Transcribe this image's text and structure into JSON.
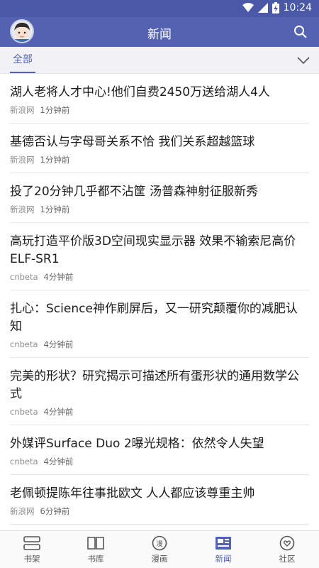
{
  "status": {
    "time": "10:24",
    "battery_icon": "battery-charging-icon",
    "signal_icon": "signal-icon",
    "wifi_icon": "wifi-icon"
  },
  "header": {
    "title": "新闻",
    "search_icon": "search-icon",
    "avatar": "user-avatar"
  },
  "tabs": {
    "active": "全部",
    "expand_icon": "chevron-down-icon"
  },
  "news": [
    {
      "headline": "湖人老将人才中心!他们自费2450万送给湖人4人",
      "source": "新浪网",
      "time": "1分钟前"
    },
    {
      "headline": "基德否认与字母哥关系不恰 我们关系超越篮球",
      "source": "新浪网",
      "time": "1分钟前"
    },
    {
      "headline": "投了20分钟几乎都不沾筐 汤普森神射征服新秀",
      "source": "新浪网",
      "time": "1分钟前"
    },
    {
      "headline": "高玩打造平价版3D空间现实显示器 效果不输索尼高价ELF-SR1",
      "source": "cnbeta",
      "time": "4分钟前"
    },
    {
      "headline": "扎心：Science神作刷屏后，又一研究颠覆你的减肥认知",
      "source": "cnbeta",
      "time": "4分钟前"
    },
    {
      "headline": "完美的形状？研究揭示可描述所有蛋形状的通用数学公式",
      "source": "cnbeta",
      "time": "4分钟前"
    },
    {
      "headline": "外媒评Surface Duo 2曝光规格：依然令人失望",
      "source": "cnbeta",
      "time": "4分钟前"
    },
    {
      "headline": "老佩顿提陈年往事批欧文 人人都应该尊重主帅",
      "source": "新浪网",
      "time": "6分钟前"
    }
  ],
  "nav": [
    {
      "label": "书架",
      "icon": "bookshelf-icon"
    },
    {
      "label": "书库",
      "icon": "open-book-icon"
    },
    {
      "label": "漫画",
      "icon": "comic-icon"
    },
    {
      "label": "新闻",
      "icon": "newspaper-icon",
      "active": true
    },
    {
      "label": "社区",
      "icon": "community-heart-icon"
    }
  ],
  "colors": {
    "primary": "#5462b2",
    "statusbar": "#4a58a8"
  }
}
